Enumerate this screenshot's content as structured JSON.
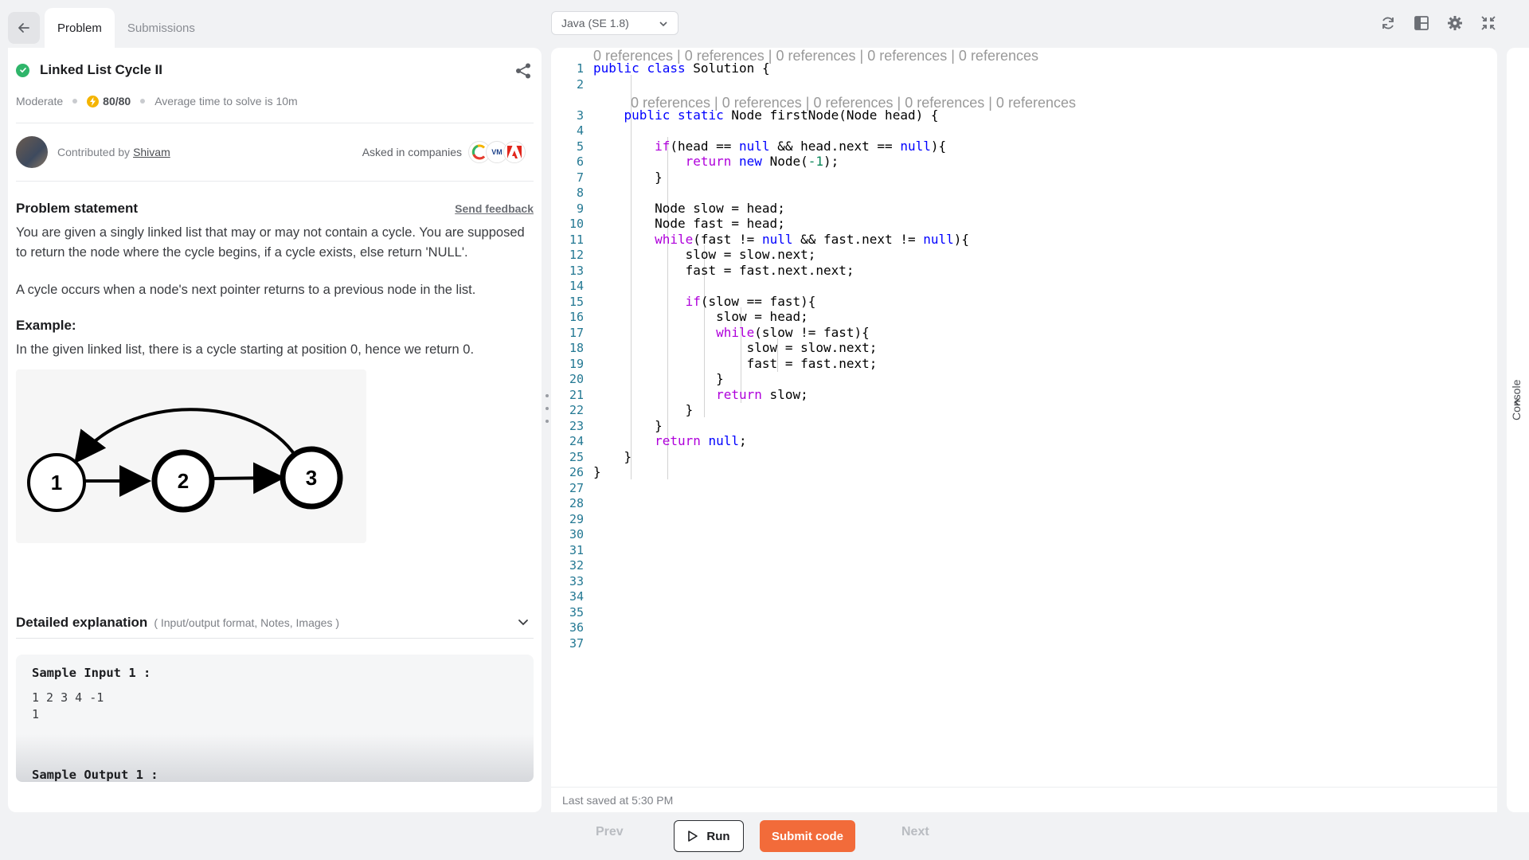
{
  "tabs": [
    {
      "label": "Problem"
    },
    {
      "label": "Submissions"
    }
  ],
  "problem": {
    "title": "Linked List Cycle II",
    "difficulty": "Moderate",
    "score": "80/80",
    "avg_time": "Average time to solve is 10m",
    "contributed_by": "Contributed by",
    "contributor": "Shivam",
    "asked_in": "Asked in companies",
    "companies": [
      "Cvent",
      "VMware",
      "Adobe"
    ]
  },
  "statement": {
    "heading": "Problem statement",
    "feedback": "Send feedback",
    "para1": "You are given a singly linked list that may or may not contain a cycle. You are supposed to return the node where the cycle begins, if a cycle exists, else return 'NULL'.",
    "para2": "A cycle occurs when a node's next pointer returns to a previous node in the list.",
    "example_heading": "Example:",
    "example_text": "In the given linked list, there is a cycle starting at position 0, hence we return 0.",
    "diagram_nodes": [
      "1",
      "2",
      "3"
    ]
  },
  "details": {
    "title": "Detailed explanation",
    "subtitle": "( Input/output format, Notes, Images )",
    "sample_input_label": "Sample Input 1 :",
    "sample_input_lines": [
      "1 2 3 4 -1",
      "1"
    ],
    "sample_output_label": "Sample Output 1 :"
  },
  "editor": {
    "language": "Java (SE 1.8)",
    "code_lens_class": "0 references | 0 references | 0 references | 0 references | 0 references",
    "code_lens_method": "0 references | 0 references | 0 references | 0 references | 0 references",
    "line_count": 37,
    "last_saved": "Last saved at 5:30 PM"
  },
  "console_label": "Console",
  "bottom": {
    "prev": "Prev",
    "run": "Run",
    "submit": "Submit code",
    "next": "Next"
  },
  "colors": {
    "accent": "#f26b3a",
    "success": "#2fb56a",
    "score": "#f4b400"
  }
}
